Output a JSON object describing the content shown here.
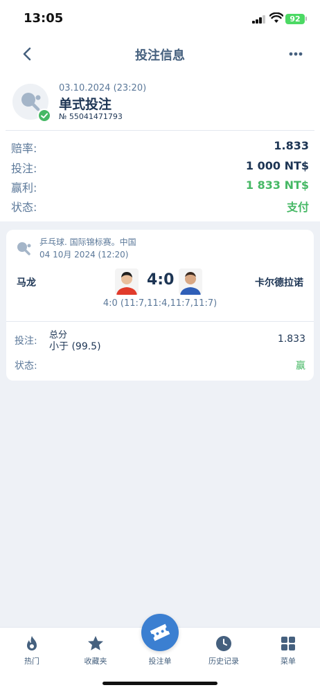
{
  "status_bar": {
    "time": "13:05",
    "battery": "92"
  },
  "header": {
    "title": "投注信息"
  },
  "bet": {
    "date": "03.10.2024 (23:20)",
    "type": "单式投注",
    "number": "№ 55041471793",
    "rows": [
      {
        "label": "赔率:",
        "value": "1.833"
      },
      {
        "label": "投注:",
        "value": "1 000 NT$"
      },
      {
        "label": "赢利:",
        "value": "1 833 NT$"
      },
      {
        "label": "状态:",
        "value": "支付"
      }
    ]
  },
  "event": {
    "league": "乒乓球. 国际锦标赛。中国",
    "date": "04 10月 2024 (12:20)",
    "team1": "马龙",
    "team2": "卡尔德拉诺",
    "score": "4:0",
    "set_scores": "4:0 (11:7,11:4,11:7,11:7)",
    "bet_label": "投注:",
    "market": "总分",
    "selection": "小于 (99.5)",
    "odd": "1.833",
    "status_label": "状态:",
    "result": "赢"
  },
  "nav": {
    "items": [
      {
        "label": "热门",
        "icon": "flame-icon"
      },
      {
        "label": "收藏夹",
        "icon": "star-icon"
      },
      {
        "label": "投注单",
        "icon": "ticket-icon"
      },
      {
        "label": "历史记录",
        "icon": "clock-icon"
      },
      {
        "label": "菜单",
        "icon": "grid-icon"
      }
    ]
  },
  "colors": {
    "accent": "#3b7fd1",
    "success": "#46b865",
    "text_primary": "#1d3554",
    "text_secondary": "#5b7899"
  }
}
